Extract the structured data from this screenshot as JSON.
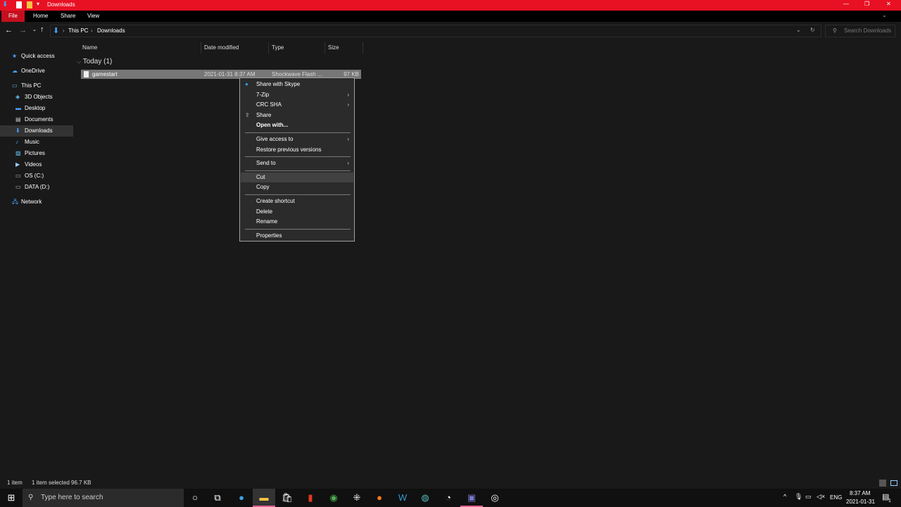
{
  "window": {
    "title": "Downloads",
    "minimize": "—",
    "maximize": "❐",
    "close": "✕",
    "accent": "#e81123"
  },
  "ribbon": {
    "tabs": [
      "File",
      "Home",
      "Share",
      "View"
    ]
  },
  "address": {
    "crumbs": [
      "This PC",
      "Downloads"
    ],
    "search_placeholder": "Search Downloads"
  },
  "sidebar": {
    "items": [
      {
        "label": "Quick access",
        "icon": "star-icon"
      },
      {
        "label": "OneDrive",
        "icon": "cloud-icon"
      },
      {
        "label": "This PC",
        "icon": "computer-icon"
      },
      {
        "label": "3D Objects",
        "icon": "cube-icon"
      },
      {
        "label": "Desktop",
        "icon": "desktop-icon"
      },
      {
        "label": "Documents",
        "icon": "document-icon"
      },
      {
        "label": "Downloads",
        "icon": "download-icon",
        "selected": true
      },
      {
        "label": "Music",
        "icon": "music-icon"
      },
      {
        "label": "Pictures",
        "icon": "picture-icon"
      },
      {
        "label": "Videos",
        "icon": "video-icon"
      },
      {
        "label": "OS (C:)",
        "icon": "drive-icon"
      },
      {
        "label": "DATA (D:)",
        "icon": "drive-icon"
      },
      {
        "label": "Network",
        "icon": "network-icon"
      }
    ]
  },
  "columns": [
    "Name",
    "Date modified",
    "Type",
    "Size"
  ],
  "group": "Today (1)",
  "file": {
    "name": "gamestart",
    "date": "2021-01-31 8:37 AM",
    "type": "Shockwave Flash ...",
    "size": "97 KB"
  },
  "menu": [
    {
      "label": "Share with Skype",
      "icon": "skype-icon"
    },
    {
      "label": "7-Zip",
      "sub": true
    },
    {
      "label": "CRC SHA",
      "sub": true
    },
    {
      "label": "Share",
      "icon": "share-icon"
    },
    {
      "label": "Open with...",
      "bold": true
    },
    {
      "sep": true
    },
    {
      "label": "Give access to",
      "sub": true
    },
    {
      "label": "Restore previous versions"
    },
    {
      "sep": true
    },
    {
      "label": "Send to",
      "sub": true
    },
    {
      "sep": true
    },
    {
      "label": "Cut",
      "hover": true
    },
    {
      "label": "Copy"
    },
    {
      "sep": true
    },
    {
      "label": "Create shortcut"
    },
    {
      "label": "Delete"
    },
    {
      "label": "Rename"
    },
    {
      "sep": true
    },
    {
      "label": "Properties"
    }
  ],
  "status": {
    "count": "1 item",
    "selected": "1 item selected  96.7 KB"
  },
  "taskbar": {
    "search_placeholder": "Type here to search",
    "time": "8:37 AM",
    "date": "2021-01-31",
    "lang": "ENG",
    "notifications": "1"
  }
}
